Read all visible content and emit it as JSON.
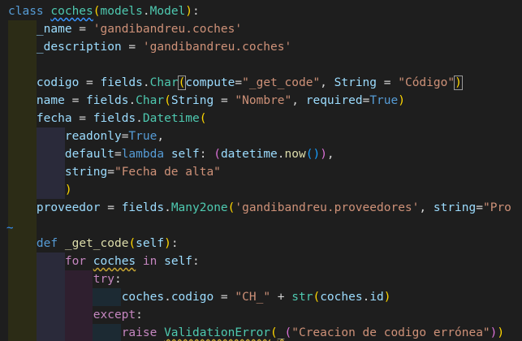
{
  "editor": {
    "language": "python",
    "colors": {
      "background": "#1e1e1e",
      "keyword": "#569cd6",
      "control": "#c586c0",
      "class": "#4ec9b0",
      "function": "#dcdcaa",
      "variable": "#9cdcfe",
      "string": "#ce9178",
      "bracket_level1": "#ffd700",
      "bracket_level2": "#da70d6",
      "bracket_level3": "#179fff",
      "indent_guide_1": "#2c2c16",
      "indent_guide_2": "#2a2a3a",
      "indent_guide_3": "#2f1f2f",
      "indent_guide_4": "#1c2a33"
    },
    "lines": [
      [
        {
          "t": "class",
          "c": "kw"
        },
        {
          "t": " "
        },
        {
          "t": "coches",
          "c": "cls squig-blue"
        },
        {
          "t": "(",
          "c": "br1"
        },
        {
          "t": "models",
          "c": "cls"
        },
        {
          "t": "."
        },
        {
          "t": "Model",
          "c": "cls"
        },
        {
          "t": ")",
          "c": "br1"
        },
        {
          "t": ":"
        }
      ],
      [
        {
          "t": "    "
        },
        {
          "t": "_name",
          "c": "var"
        },
        {
          "t": " = "
        },
        {
          "t": "'gandibandreu.coches'",
          "c": "str"
        }
      ],
      [
        {
          "t": "    "
        },
        {
          "t": "_description",
          "c": "var"
        },
        {
          "t": " = "
        },
        {
          "t": "'gandibandreu.coches'",
          "c": "str"
        }
      ],
      [],
      [
        {
          "t": "    "
        },
        {
          "t": "codigo",
          "c": "var"
        },
        {
          "t": " = "
        },
        {
          "t": "fields",
          "c": "var"
        },
        {
          "t": "."
        },
        {
          "t": "Char",
          "c": "cls"
        },
        {
          "t": "(",
          "c": "br1 boxed"
        },
        {
          "t": "compute",
          "c": "var"
        },
        {
          "t": "="
        },
        {
          "t": "\"_get_code\"",
          "c": "str"
        },
        {
          "t": ", "
        },
        {
          "t": "String",
          "c": "var"
        },
        {
          "t": " = "
        },
        {
          "t": "\"Código\"",
          "c": "str"
        },
        {
          "t": ")",
          "c": "br1 boxed"
        }
      ],
      [
        {
          "t": "    "
        },
        {
          "t": "name",
          "c": "var"
        },
        {
          "t": " = "
        },
        {
          "t": "fields",
          "c": "var"
        },
        {
          "t": "."
        },
        {
          "t": "Char",
          "c": "cls"
        },
        {
          "t": "(",
          "c": "br1"
        },
        {
          "t": "String",
          "c": "var"
        },
        {
          "t": " = "
        },
        {
          "t": "\"Nombre\"",
          "c": "str"
        },
        {
          "t": ", "
        },
        {
          "t": "required",
          "c": "var"
        },
        {
          "t": "="
        },
        {
          "t": "True",
          "c": "kw"
        },
        {
          "t": ")",
          "c": "br1"
        }
      ],
      [
        {
          "t": "    "
        },
        {
          "t": "fecha",
          "c": "var"
        },
        {
          "t": " = "
        },
        {
          "t": "fields",
          "c": "var"
        },
        {
          "t": "."
        },
        {
          "t": "Datetime",
          "c": "cls"
        },
        {
          "t": "(",
          "c": "br1"
        }
      ],
      [
        {
          "t": "        "
        },
        {
          "t": "readonly",
          "c": "var"
        },
        {
          "t": "="
        },
        {
          "t": "True",
          "c": "kw"
        },
        {
          "t": ","
        }
      ],
      [
        {
          "t": "        "
        },
        {
          "t": "default",
          "c": "var"
        },
        {
          "t": "="
        },
        {
          "t": "lambda",
          "c": "kw"
        },
        {
          "t": " "
        },
        {
          "t": "self",
          "c": "var"
        },
        {
          "t": ": "
        },
        {
          "t": "(",
          "c": "br2"
        },
        {
          "t": "datetime",
          "c": "var"
        },
        {
          "t": "."
        },
        {
          "t": "now",
          "c": "fn"
        },
        {
          "t": "(",
          "c": "br3"
        },
        {
          "t": ")",
          "c": "br3"
        },
        {
          "t": ")",
          "c": "br2"
        },
        {
          "t": ","
        }
      ],
      [
        {
          "t": "        "
        },
        {
          "t": "string",
          "c": "var"
        },
        {
          "t": "="
        },
        {
          "t": "\"Fecha de alta\"",
          "c": "str"
        }
      ],
      [
        {
          "t": "        "
        },
        {
          "t": ")",
          "c": "br1"
        }
      ],
      [
        {
          "t": "    "
        },
        {
          "t": "proveedor",
          "c": "var"
        },
        {
          "t": " = "
        },
        {
          "t": "fields",
          "c": "var"
        },
        {
          "t": "."
        },
        {
          "t": "Many2one",
          "c": "cls"
        },
        {
          "t": "(",
          "c": "br1"
        },
        {
          "t": "'gandibandreu.proveedores'",
          "c": "str"
        },
        {
          "t": ", "
        },
        {
          "t": "string",
          "c": "var"
        },
        {
          "t": "="
        },
        {
          "t": "\"Pro",
          "c": "str"
        }
      ],
      [],
      [
        {
          "t": "    "
        },
        {
          "t": "def",
          "c": "kw"
        },
        {
          "t": " "
        },
        {
          "t": "_get_code",
          "c": "fn"
        },
        {
          "t": "(",
          "c": "br1"
        },
        {
          "t": "self",
          "c": "var"
        },
        {
          "t": ")",
          "c": "br1"
        },
        {
          "t": ":"
        }
      ],
      [
        {
          "t": "        "
        },
        {
          "t": "for",
          "c": "ctl"
        },
        {
          "t": " "
        },
        {
          "t": "coches",
          "c": "var squig"
        },
        {
          "t": " "
        },
        {
          "t": "in",
          "c": "ctl"
        },
        {
          "t": " "
        },
        {
          "t": "self",
          "c": "var"
        },
        {
          "t": ":"
        }
      ],
      [
        {
          "t": "            "
        },
        {
          "t": "try",
          "c": "ctl"
        },
        {
          "t": ":"
        }
      ],
      [
        {
          "t": "                "
        },
        {
          "t": "coches",
          "c": "var"
        },
        {
          "t": "."
        },
        {
          "t": "codigo",
          "c": "var"
        },
        {
          "t": " = "
        },
        {
          "t": "\"CH_\"",
          "c": "str"
        },
        {
          "t": " + "
        },
        {
          "t": "str",
          "c": "cls"
        },
        {
          "t": "(",
          "c": "br1"
        },
        {
          "t": "coches",
          "c": "var"
        },
        {
          "t": "."
        },
        {
          "t": "id",
          "c": "var"
        },
        {
          "t": ")",
          "c": "br1"
        }
      ],
      [
        {
          "t": "            "
        },
        {
          "t": "except",
          "c": "ctl"
        },
        {
          "t": ":"
        }
      ],
      [
        {
          "t": "                "
        },
        {
          "t": "raise",
          "c": "ctl"
        },
        {
          "t": " "
        },
        {
          "t": "ValidationError",
          "c": "cls squig"
        },
        {
          "t": "(",
          "c": "br1"
        },
        {
          "t": "_",
          "c": "fn squig"
        },
        {
          "t": "(",
          "c": "br2"
        },
        {
          "t": "\"Creacion de codigo errónea\"",
          "c": "str"
        },
        {
          "t": ")",
          "c": "br2"
        },
        {
          "t": ")",
          "c": "br1"
        }
      ]
    ],
    "fold_icon": "fold-chevron-icon",
    "fold_icon_glyph": "~"
  }
}
